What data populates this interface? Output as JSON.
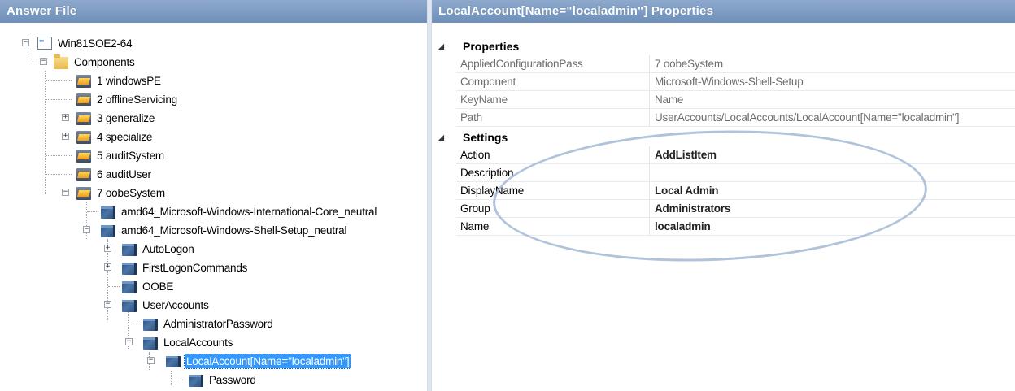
{
  "left_panel": {
    "title": "Answer File"
  },
  "tree": {
    "root": "Win81SOE2-64",
    "components": "Components",
    "pass1": "1 windowsPE",
    "pass2": "2 offlineServicing",
    "pass3": "3 generalize",
    "pass4": "4 specialize",
    "pass5": "5 auditSystem",
    "pass6": "6 auditUser",
    "pass7": "7 oobeSystem",
    "comp_intl": "amd64_Microsoft-Windows-International-Core_neutral",
    "comp_shell": "amd64_Microsoft-Windows-Shell-Setup_neutral",
    "autologon": "AutoLogon",
    "firstlogon": "FirstLogonCommands",
    "oobe": "OOBE",
    "useraccounts": "UserAccounts",
    "adminpassword": "AdministratorPassword",
    "localaccounts": "LocalAccounts",
    "localaccount": "LocalAccount[Name=\"localadmin\"]",
    "password": "Password"
  },
  "right_panel": {
    "title": "LocalAccount[Name=\"localadmin\"] Properties"
  },
  "properties": {
    "category_properties": "Properties",
    "category_settings": "Settings",
    "rows": [
      {
        "name": "AppliedConfigurationPass",
        "value": "7 oobeSystem"
      },
      {
        "name": "Component",
        "value": "Microsoft-Windows-Shell-Setup"
      },
      {
        "name": "KeyName",
        "value": "Name"
      },
      {
        "name": "Path",
        "value": "UserAccounts/LocalAccounts/LocalAccount[Name=\"localadmin\"]"
      }
    ],
    "settings": [
      {
        "name": "Action",
        "value": "AddListItem"
      },
      {
        "name": "Description",
        "value": ""
      },
      {
        "name": "DisplayName",
        "value": "Local Admin"
      },
      {
        "name": "Group",
        "value": "Administrators"
      },
      {
        "name": "Name",
        "value": "localadmin"
      }
    ]
  },
  "colors": {
    "title_bar": "#7f9cc3",
    "selection": "#3399ff",
    "annotation": "#a9bcd6"
  }
}
